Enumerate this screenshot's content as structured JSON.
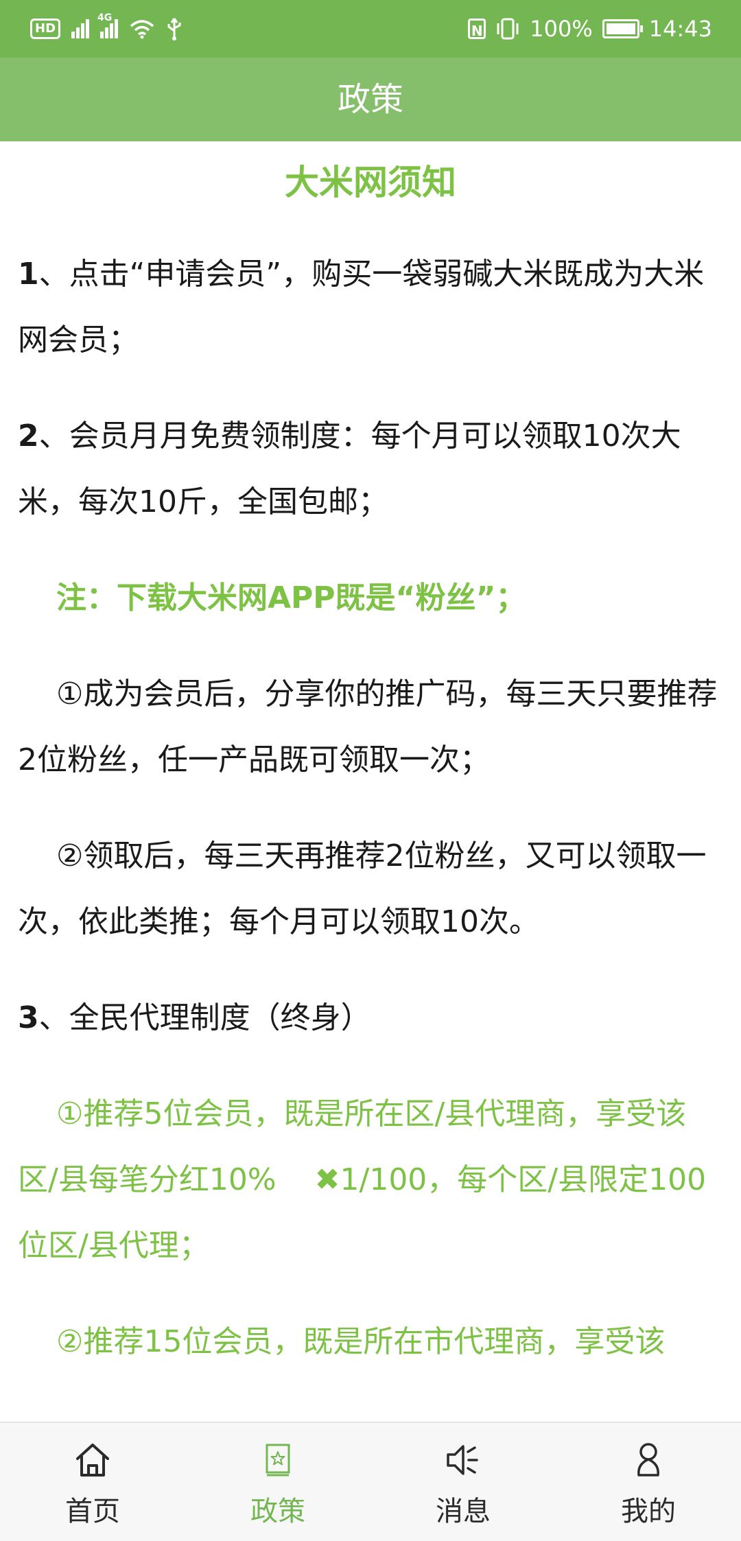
{
  "status_bar": {
    "hd": "HD",
    "net_tag": "4G",
    "battery": "100%",
    "time": "14:43",
    "battery_level": 1.0
  },
  "header": {
    "title": "政策"
  },
  "article": {
    "title": "大米网须知",
    "p1": {
      "num": "1",
      "text": "、点击“申请会员”，购买一袋弱碱大米既成为大米网会员；"
    },
    "p2": {
      "num": "2",
      "text": "、会员月月免费领制度：每个月可以领取10次大米，每次10斤，全国包邮；"
    },
    "note": "注：下载大米网APP既是“粉丝”；",
    "p2a": "①成为会员后，分享你的推广码，每三天只要推荐2位粉丝，任一产品既可领取一次；",
    "p2b": "②领取后，每三天再推荐2位粉丝，又可以领取一次，依此类推；每个月可以领取10次。",
    "p3": {
      "num": "3",
      "text": "、全民代理制度（终身）"
    },
    "p3a_before": "①推荐5位会员，既是所在区/县代理商，享受该区/县每笔分红10%",
    "p3a_after": "1/100，每个区/县限定100位区/县代理；",
    "p3b": "②推荐15位会员，既是所在市代理商，享受该"
  },
  "nav": {
    "items": [
      {
        "label": "首页",
        "icon": "home-icon",
        "active": false
      },
      {
        "label": "政策",
        "icon": "policy-icon",
        "active": true
      },
      {
        "label": "消息",
        "icon": "speaker-icon",
        "active": false
      },
      {
        "label": "我的",
        "icon": "user-icon",
        "active": false
      }
    ]
  },
  "colors": {
    "status_bar": "#74b752",
    "title_bar": "#86bf6b",
    "accent_green": "#7dc145",
    "text": "#1a1a1a"
  }
}
